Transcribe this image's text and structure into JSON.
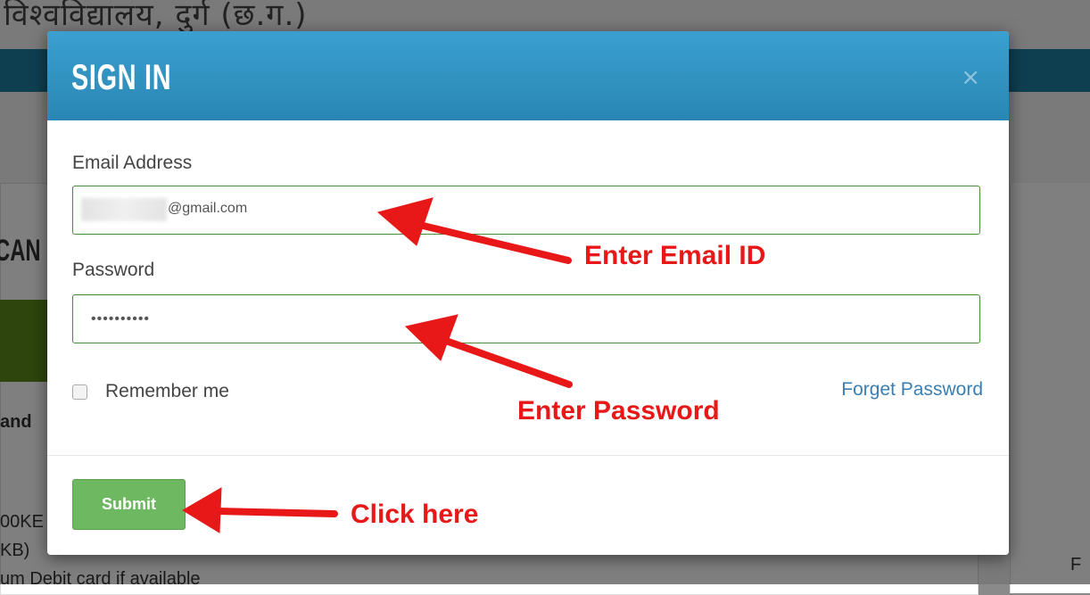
{
  "background": {
    "title": "विश्वविद्यालय, दुर्ग (छ.ग.)",
    "partial_heading": "CAN",
    "partial_text_1": "and",
    "partial_text_2": "00KE",
    "partial_text_3": "KB)",
    "partial_text_4": "um  Debit card if available",
    "partial_text_5": "F"
  },
  "modal": {
    "title": "SIGN IN",
    "close_symbol": "×",
    "email_label": "Email Address",
    "email_value": "@gmail.com",
    "password_label": "Password",
    "password_value": "••••••••••",
    "remember_label": "Remember me",
    "forget_link": "Forget Password",
    "submit_label": "Submit"
  },
  "annotations": {
    "email": "Enter Email ID",
    "password": "Enter Password",
    "submit": "Click here"
  },
  "colors": {
    "header": "#2f93c3",
    "submit": "#6db860",
    "annotation": "#e81818",
    "link": "#3b7fb2"
  }
}
